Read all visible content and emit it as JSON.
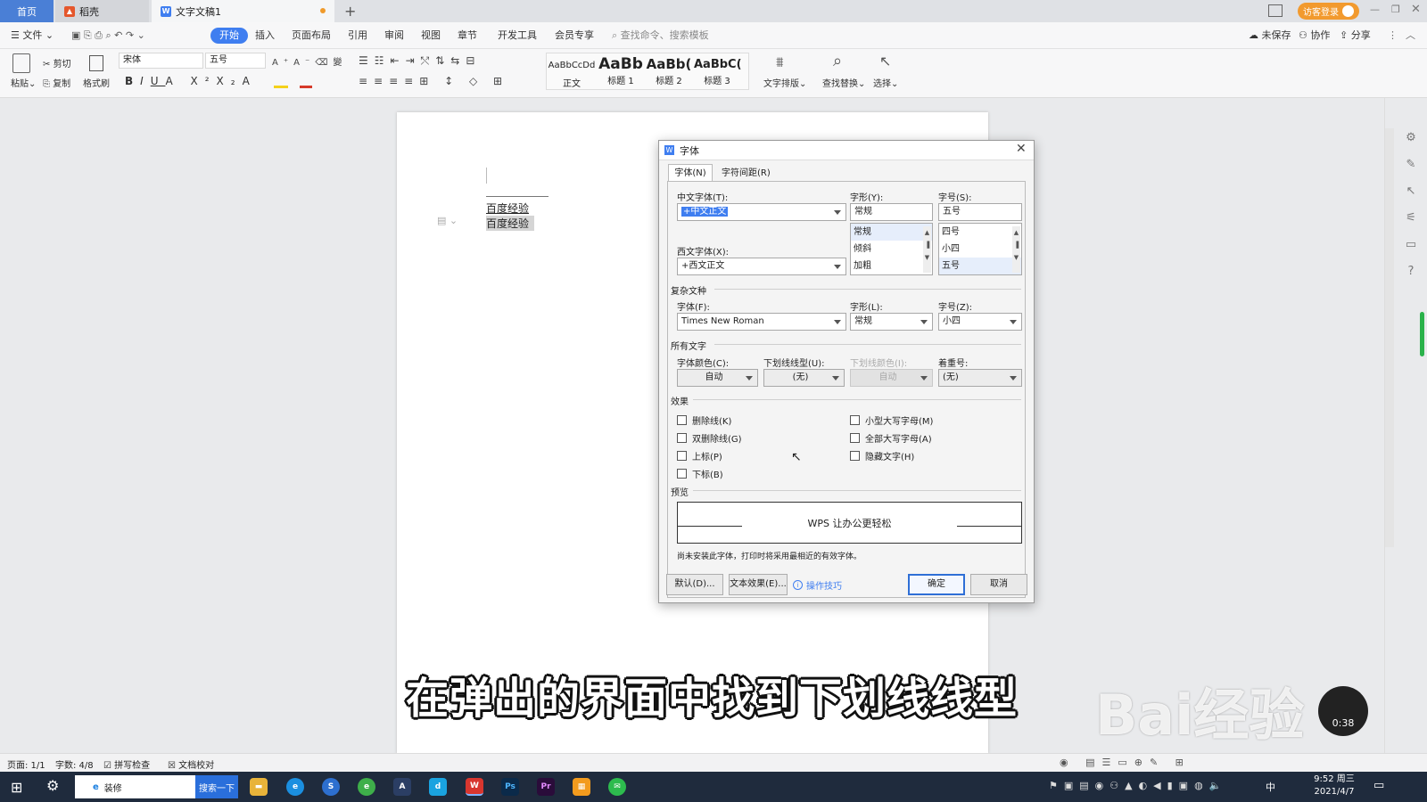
{
  "tabs": {
    "home": "首页",
    "daoke": "稻壳",
    "doc": "文字文稿1",
    "login": "访客登录"
  },
  "menu": {
    "file": "文件",
    "items": [
      "开始",
      "插入",
      "页面布局",
      "引用",
      "审阅",
      "视图",
      "章节",
      "开发工具",
      "会员专享"
    ],
    "search": "查找命令、搜索模板",
    "unsaved": "未保存",
    "collab": "协作",
    "share": "分享"
  },
  "ribbon": {
    "paste": "粘贴",
    "cut": "剪切",
    "copy": "复制",
    "format_painter": "格式刷",
    "font": "宋体",
    "size": "五号",
    "styles": [
      {
        "preview": "AaBbCcDd",
        "label": "正文"
      },
      {
        "preview": "AaBb",
        "label": "标题 1"
      },
      {
        "preview": "AaBb(",
        "label": "标题 2"
      },
      {
        "preview": "AaBbC(",
        "label": "标题 3"
      }
    ],
    "text_layout": "文字排版",
    "find_replace": "查找替换",
    "select": "选择"
  },
  "doc": {
    "lines": [
      "百度经验",
      "百度经验"
    ]
  },
  "dialog": {
    "title": "字体",
    "tab1": "字体(N)",
    "tab2": "字符间距(R)",
    "cn_font_label": "中文字体(T):",
    "cn_font_value": "+中文正文",
    "style_label": "字形(Y):",
    "style_value": "常规",
    "style_list": [
      "常规",
      "倾斜",
      "加粗"
    ],
    "size_label": "字号(S):",
    "size_value": "五号",
    "size_list": [
      "四号",
      "小四",
      "五号"
    ],
    "west_font_label": "西文字体(X):",
    "west_font_value": "+西文正文",
    "complex_section": "复杂文种",
    "cx_font_label": "字体(F):",
    "cx_font_value": "Times New Roman",
    "cx_style_label": "字形(L):",
    "cx_style_value": "常规",
    "cx_size_label": "字号(Z):",
    "cx_size_value": "小四",
    "all_section": "所有文字",
    "color_label": "字体颜色(C):",
    "color_value": "自动",
    "underline_label": "下划线线型(U):",
    "underline_value": "(无)",
    "ucolor_label": "下划线颜色(I):",
    "ucolor_value": "自动",
    "emph_label": "着重号:",
    "emph_value": "(无)",
    "effects_section": "效果",
    "effects_left": [
      "删除线(K)",
      "双删除线(G)",
      "上标(P)",
      "下标(B)"
    ],
    "effects_right": [
      "小型大写字母(M)",
      "全部大写字母(A)",
      "隐藏文字(H)"
    ],
    "preview_section": "预览",
    "preview_text": "WPS 让办公更轻松",
    "note": "尚未安装此字体，打印时将采用最相近的有效字体。",
    "btn_default": "默认(D)...",
    "btn_effects": "文本效果(E)...",
    "tips": "操作技巧",
    "btn_ok": "确定",
    "btn_cancel": "取消"
  },
  "caption": "在弹出的界面中找到下划线线型",
  "watermark": "Bai经验",
  "video_time": "0:38",
  "status": {
    "page": "页面: 1/1",
    "words": "字数: 4/8",
    "spell": "拼写检查",
    "proof": "文档校对"
  },
  "taskbar": {
    "search_text": "装修",
    "search_btn": "搜索一下",
    "time": "9:52 周三",
    "date": "2021/4/7",
    "ime": "中"
  },
  "colors": {
    "accent": "#3f7ef0",
    "dialog_ok_border": "#2f6fd6"
  }
}
